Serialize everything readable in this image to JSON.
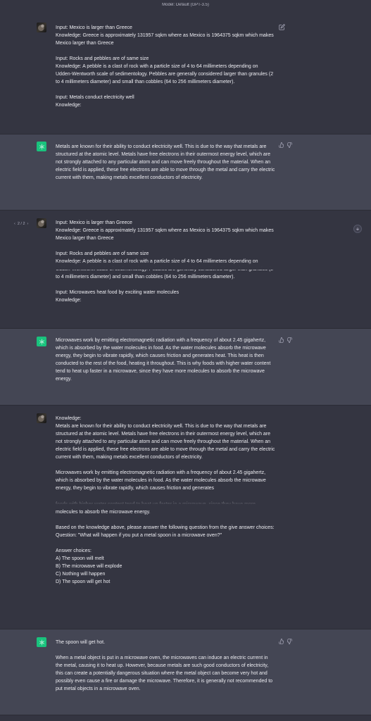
{
  "header": {
    "model_label": "Model: Default (GPT-3.5)"
  },
  "messages": [
    {
      "role": "user",
      "text": "Input: Mexico is larger than Greece\nKnowledge: Greece is approximately 131957 sqkm where as Mexico is 1964375 sqkm which makes Mexico larger than Greece\n\nInput: Rocks and pebbles are of same size\nKnowledge: A pebble is a clast of rock with a particle size of 4 to 64 millimeters depending on Udden-Wentworth scale of sedimentology. Pebbles are generally considered larger than granules (2 to 4 millimeters diameter) and small than cobbles (64 to 256 millimeters diameter).\n\nInput: Metals conduct electricity well\nKnowledge:"
    },
    {
      "role": "assistant",
      "text": "Metals are known for their ability to conduct electricity well. This is due to the way that metals are structured at the atomic level. Metals have free electrons in their outermost energy level, which are not strongly attached to any particular atom and can move freely throughout the material. When an electric field is applied, these free electrons are able to move through the metal and carry the electric current with them, making metals excellent conductors of electricity."
    },
    {
      "role": "user",
      "nav": "2 / 2",
      "text": "Input: Mexico is larger than Greece\nKnowledge: Greece is approximately 131957 sqkm where as Mexico is 1964375 sqkm which makes Mexico larger than Greece\n\nInput: Rocks and pebbles are of same size\nKnowledge: A pebble is a clast of rock with a particle size of 4 to 64 millimeters depending on Udden-Wentworth scale of sedimentology. Pebbles are generally considered larger than granules (2 to 4 millimeters diameter) and small than cobbles (64 to 256 millimeters diameter).\n\nInput: Microwaves heat food by exciting water molecules\nKnowledge:"
    },
    {
      "role": "assistant",
      "text": "Microwaves work by emitting electromagnetic radiation with a frequency of about 2.45 gigahertz, which is absorbed by the water molecules in food. As the water molecules absorb the microwave energy, they begin to vibrate rapidly, which causes friction and generates heat. This heat is then conducted to the rest of the food, heating it throughout. This is why foods with higher water content tend to heat up faster in a microwave, since they have more molecules to absorb the microwave energy."
    },
    {
      "role": "user",
      "text": "Knowledge:\nMetals are known for their ability to conduct electricity well. This is due to the way that metals are structured at the atomic level. Metals have free electrons in their outermost energy level, which are not strongly attached to any particular atom and can move freely throughout the material. When an electric field is applied, these free electrons are able to move through the metal and carry the electric current with them, making metals excellent conductors of electricity.\n\nMicrowaves work by emitting electromagnetic radiation with a frequency of about 2.45 gigahertz, which is absorbed by the water molecules in food. As the water molecules absorb the microwave energy, they begin to vibrate rapidly, which causes friction and generates\n\nfoods with higher water content tend to heat up faster in a microwave, since they have more molecules to absorb the microwave energy.\n\nBased on the knowledge above, please answer the following question from the give answer choices:\nQuestion: \"What will happen if you put a metal spoon in a microwave oven?\"\n\nAnswer choices:\nA) The spoon will melt\nB) The microwave will explode\nC) Nothing will happen\nD) The spoon will get hot"
    },
    {
      "role": "assistant",
      "text": "The spoon will get hot.\n\nWhen a metal object is put in a microwave oven, the microwaves can induce an electric current in the metal, causing it to heat up. However, because metals are such good conductors of electricity, this can create a potentially dangerous situation where the metal object can become very hot and possibly even cause a fire or damage the microwave. Therefore, it is generally not recommended to put metal objects in a microwave oven."
    }
  ],
  "icons": {
    "edit": "edit-icon",
    "thumbs_up": "thumbs-up-icon",
    "thumbs_down": "thumbs-down-icon",
    "scroll_down": "arrow-down-circle-icon",
    "prev": "chevron-left-icon",
    "next": "chevron-right-icon"
  },
  "colors": {
    "user_bg": "#343541",
    "assistant_bg": "#444654",
    "text": "#ececf1",
    "gpt_green": "#19c37d"
  }
}
